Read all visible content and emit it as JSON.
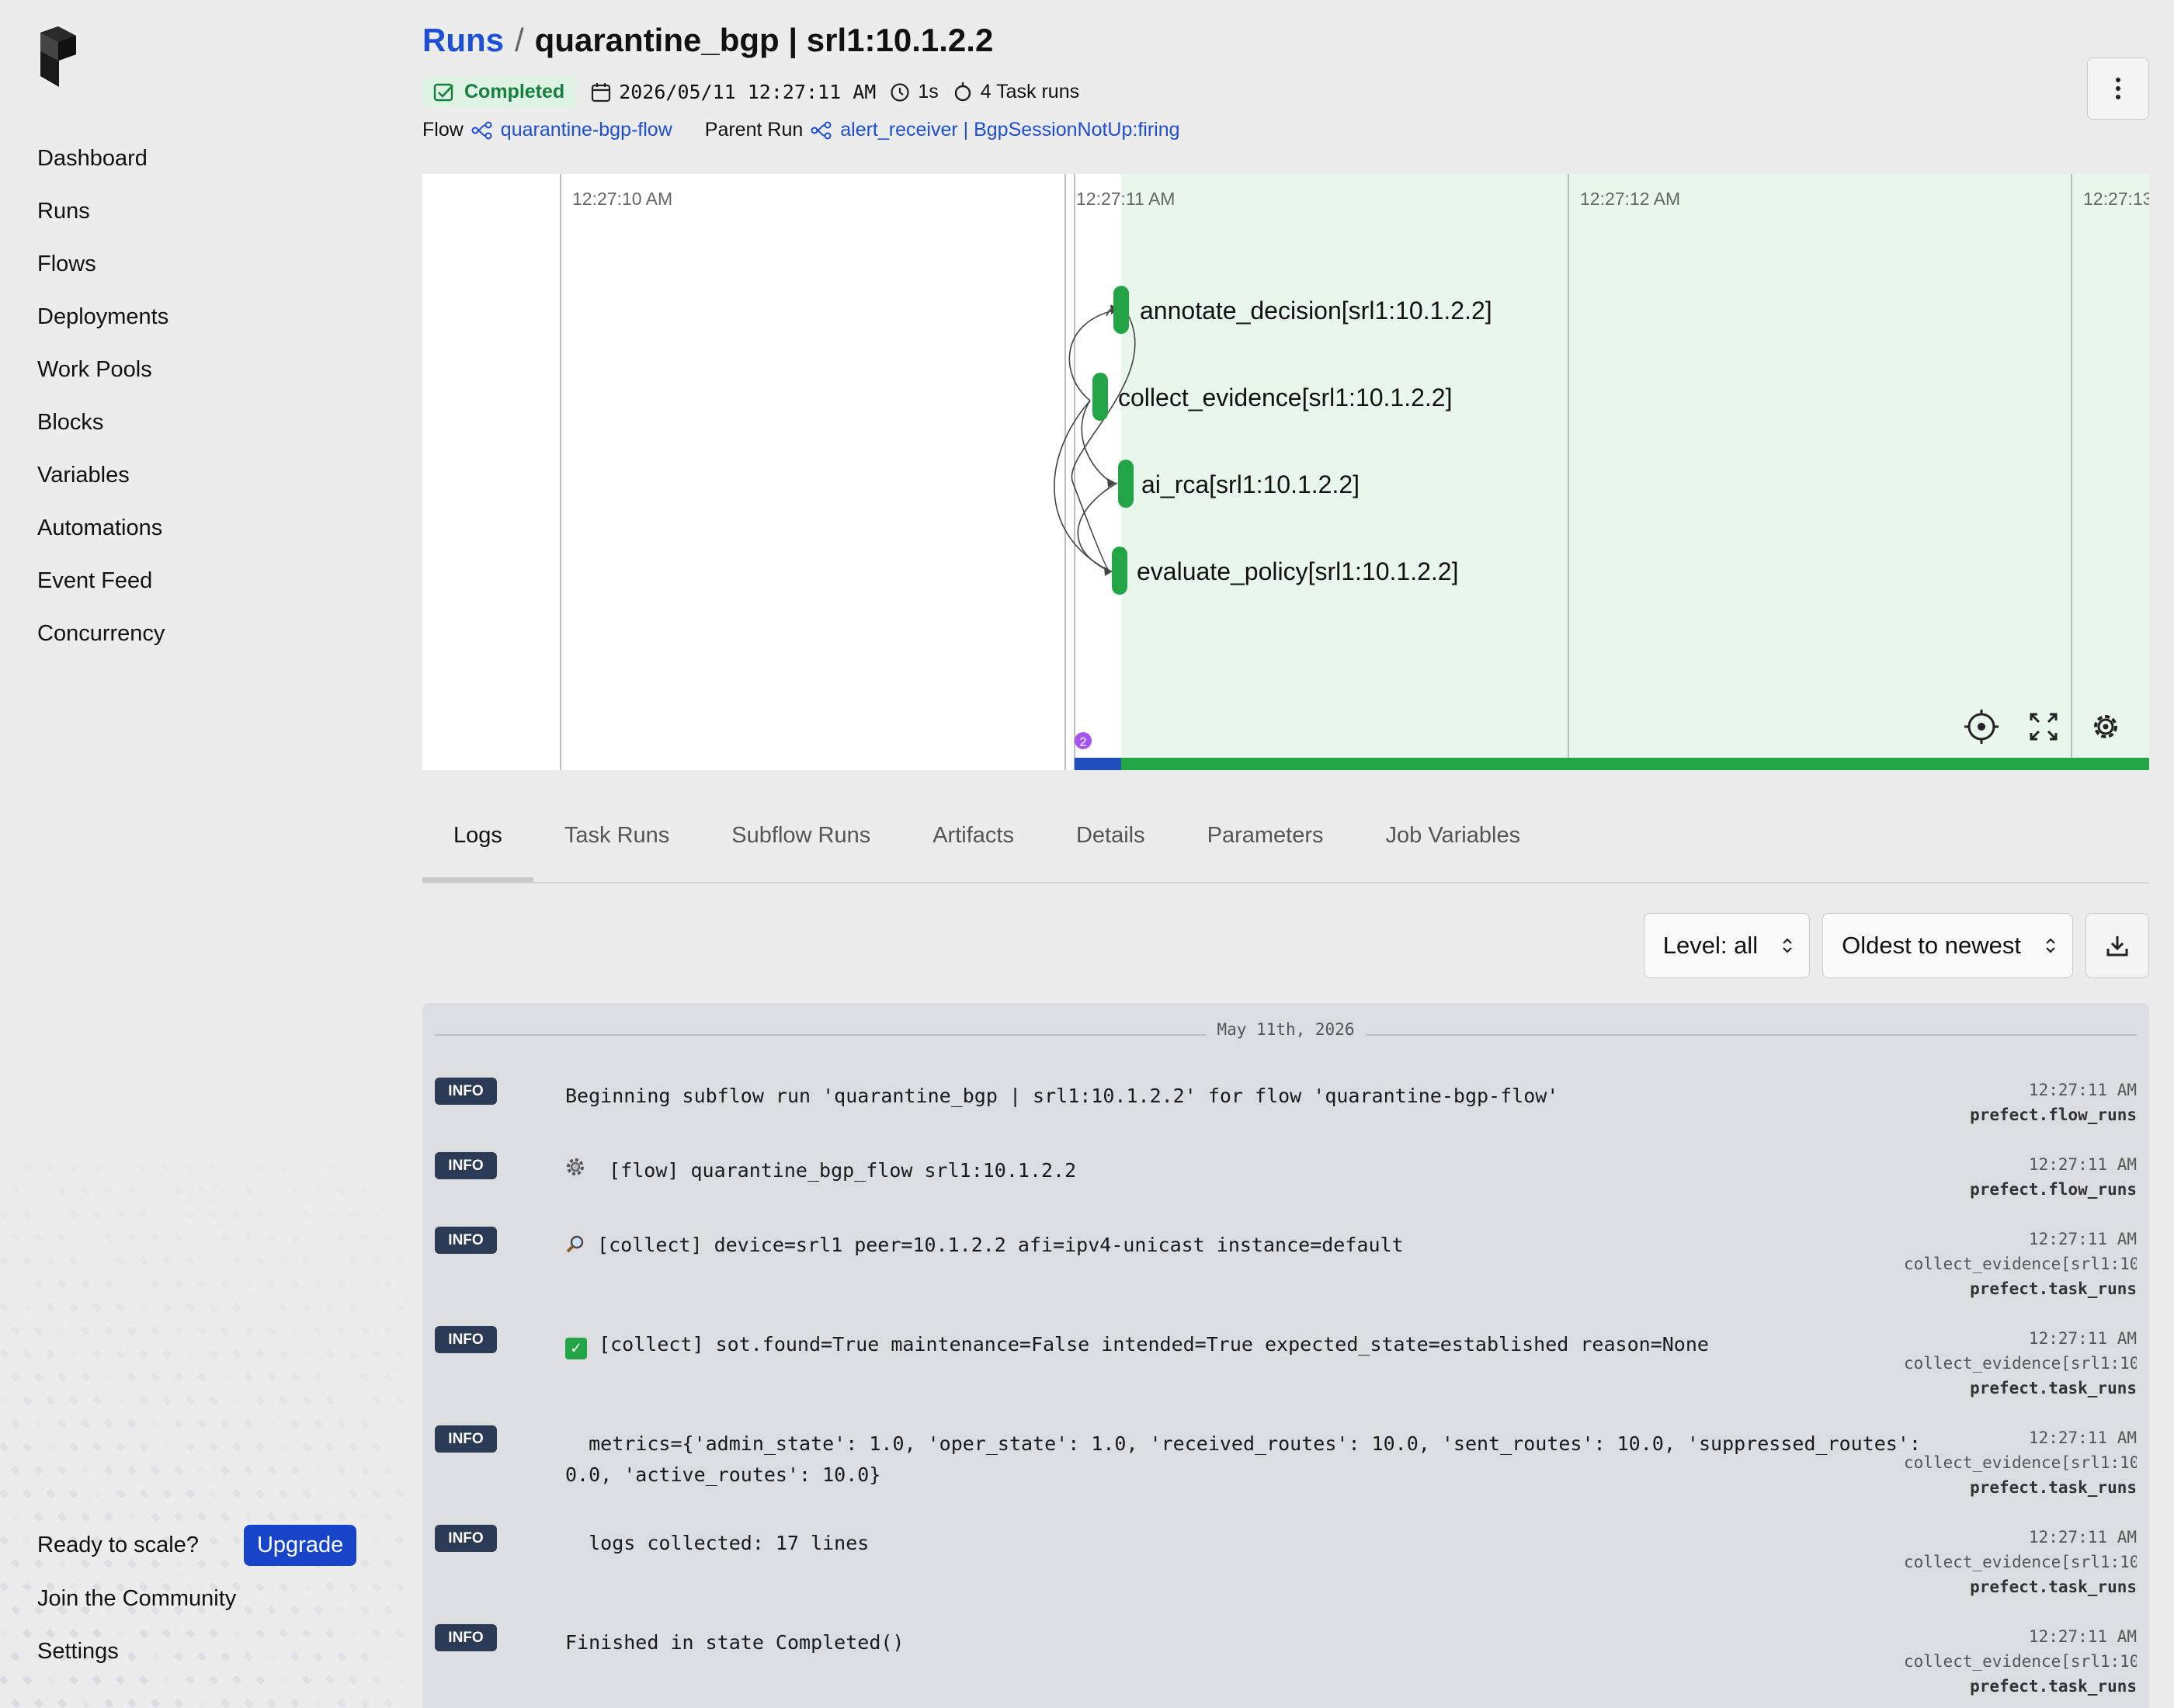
{
  "sidebar": {
    "items": [
      "Dashboard",
      "Runs",
      "Flows",
      "Deployments",
      "Work Pools",
      "Blocks",
      "Variables",
      "Automations",
      "Event Feed",
      "Concurrency"
    ],
    "ready_text": "Ready to scale?",
    "upgrade_label": "Upgrade",
    "community_label": "Join the Community",
    "settings_label": "Settings"
  },
  "header": {
    "breadcrumb_root": "Runs",
    "separator": "/",
    "title": "quarantine_bgp | srl1:10.1.2.2",
    "status": "Completed",
    "datetime": "2026/05/11 12:27:11 AM",
    "duration": "1s",
    "task_runs": "4 Task runs",
    "flow_label": "Flow",
    "flow_name": "quarantine-bgp-flow",
    "parent_label": "Parent Run",
    "parent_name": "alert_receiver | BgpSessionNotUp:firing"
  },
  "timeline": {
    "ticks": [
      "12:27:10 AM",
      "12:27:11 AM",
      "12:27:12 AM",
      "12:27:13"
    ],
    "nodes": [
      "annotate_decision[srl1:10.1.2.2]",
      "collect_evidence[srl1:10.1.2.2]",
      "ai_rca[srl1:10.1.2.2]",
      "evaluate_policy[srl1:10.1.2.2]"
    ],
    "event_count": "2",
    "colors": {
      "completed": "#22a447",
      "shade": "#e8f6ec",
      "scheduled": "#1f4fb8",
      "event": "#a855f7"
    }
  },
  "tabs": [
    "Logs",
    "Task Runs",
    "Subflow Runs",
    "Artifacts",
    "Details",
    "Parameters",
    "Job Variables"
  ],
  "controls": {
    "level": "Level: all",
    "order": "Oldest to newest"
  },
  "logs": {
    "date": "May 11th, 2026",
    "entries": [
      {
        "level": "INFO",
        "message": "Beginning subflow run 'quarantine_bgp | srl1:10.1.2.2' for flow 'quarantine-bgp-flow'",
        "time": "12:27:11 AM",
        "task": "",
        "source": "prefect.flow_runs"
      },
      {
        "level": "INFO",
        "message": "[flow] quarantine_bgp_flow srl1:10.1.2.2",
        "time": "12:27:11 AM",
        "task": "",
        "source": "prefect.flow_runs",
        "icon": "gear-icon"
      },
      {
        "level": "INFO",
        "message": "[collect] device=srl1 peer=10.1.2.2 afi=ipv4-unicast instance=default",
        "time": "12:27:11 AM",
        "task": "collect_evidence[srl1:10",
        "source": "prefect.task_runs",
        "icon": "magnifier-icon"
      },
      {
        "level": "INFO",
        "message": "[collect] sot.found=True maintenance=False intended=True expected_state=established reason=None",
        "time": "12:27:11 AM",
        "task": "collect_evidence[srl1:10",
        "source": "prefect.task_runs",
        "icon": "check-icon"
      },
      {
        "level": "INFO",
        "message": "  metrics={'admin_state': 1.0, 'oper_state': 1.0, 'received_routes': 10.0, 'sent_routes': 10.0, 'suppressed_routes': 0.0, 'active_routes': 10.0}",
        "time": "12:27:11 AM",
        "task": "collect_evidence[srl1:10",
        "source": "prefect.task_runs"
      },
      {
        "level": "INFO",
        "message": "  logs collected: 17 lines",
        "time": "12:27:11 AM",
        "task": "collect_evidence[srl1:10",
        "source": "prefect.task_runs"
      },
      {
        "level": "INFO",
        "message": "Finished in state Completed()",
        "time": "12:27:11 AM",
        "task": "collect_evidence[srl1:10",
        "source": "prefect.task_runs"
      }
    ]
  }
}
